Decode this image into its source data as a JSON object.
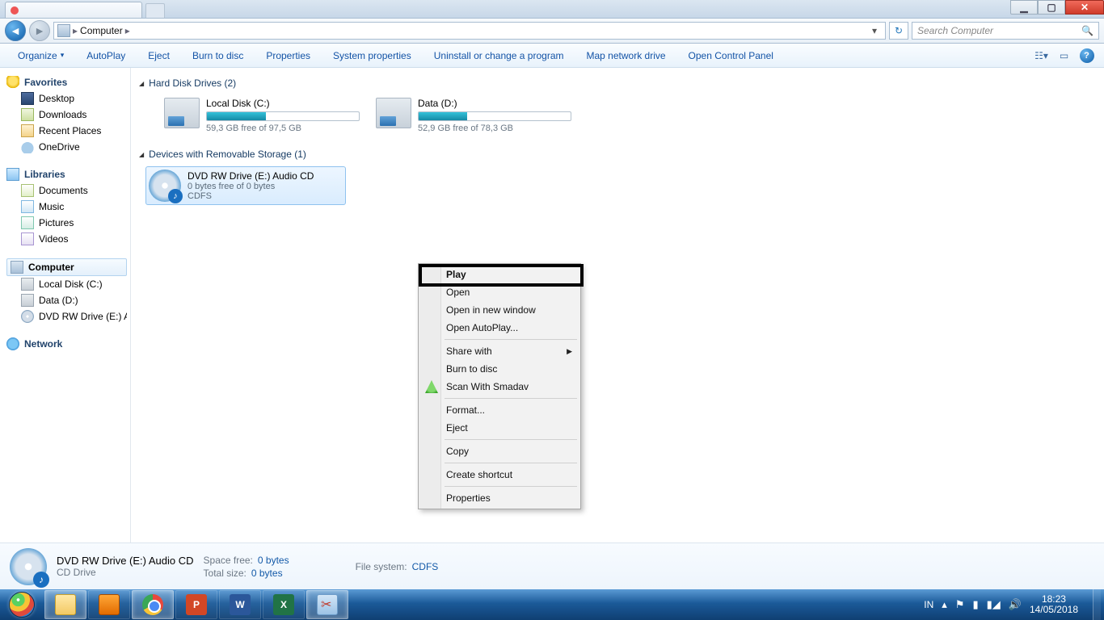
{
  "tabstrip": {
    "tab_title": "",
    "min": "▁",
    "max": "▢",
    "close": "✕"
  },
  "address": {
    "root": "Computer",
    "sep": "▸"
  },
  "search": {
    "placeholder": "Search Computer"
  },
  "cmdbar": {
    "organize": "Organize",
    "autoplay": "AutoPlay",
    "eject": "Eject",
    "burn": "Burn to disc",
    "properties": "Properties",
    "sysprops": "System properties",
    "uninstall": "Uninstall or change a program",
    "mapnet": "Map network drive",
    "controlpanel": "Open Control Panel"
  },
  "tree": {
    "favorites": "Favorites",
    "desktop": "Desktop",
    "downloads": "Downloads",
    "recent": "Recent Places",
    "onedrive": "OneDrive",
    "libraries": "Libraries",
    "documents": "Documents",
    "music": "Music",
    "pictures": "Pictures",
    "videos": "Videos",
    "computer": "Computer",
    "localC": "Local Disk (C:)",
    "dataD": "Data (D:)",
    "dvdE": "DVD RW Drive (E:) A",
    "network": "Network"
  },
  "sections": {
    "hdd": "Hard Disk Drives (2)",
    "removable": "Devices with Removable Storage (1)"
  },
  "drives": [
    {
      "name": "Local Disk (C:)",
      "free": "59,3 GB free of 97,5 GB",
      "fill": 39
    },
    {
      "name": "Data (D:)",
      "free": "52,9 GB free of 78,3 GB",
      "fill": 32
    }
  ],
  "device": {
    "name": "DVD RW Drive (E:) Audio CD",
    "free": "0 bytes free of 0 bytes",
    "fs": "CDFS"
  },
  "ctx": {
    "play": "Play",
    "open": "Open",
    "opennew": "Open in new window",
    "autoplay": "Open AutoPlay...",
    "share": "Share with",
    "burn": "Burn to disc",
    "smadav": "Scan With Smadav",
    "format": "Format...",
    "eject": "Eject",
    "copy": "Copy",
    "shortcut": "Create shortcut",
    "properties": "Properties"
  },
  "details": {
    "title": "DVD RW Drive (E:) Audio CD",
    "type": "CD Drive",
    "spacefree_k": "Space free:",
    "spacefree_v": "0 bytes",
    "totalsize_k": "Total size:",
    "totalsize_v": "0 bytes",
    "fs_k": "File system:",
    "fs_v": "CDFS"
  },
  "taskbar": {
    "lang": "IN",
    "time": "18:23",
    "date": "14/05/2018",
    "pp": "P",
    "wd": "W",
    "xl": "X"
  }
}
